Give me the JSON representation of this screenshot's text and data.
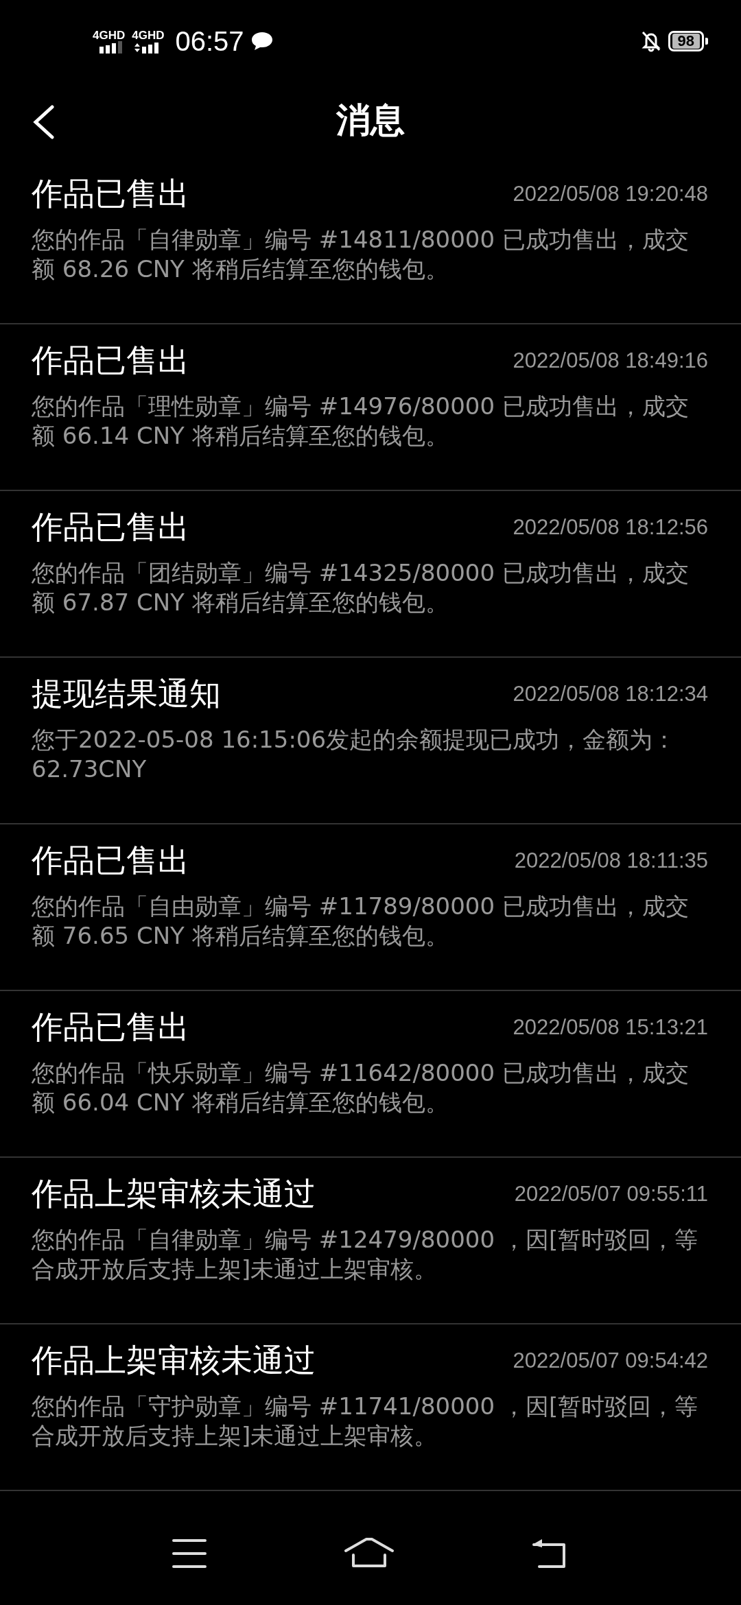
{
  "status_bar": {
    "network_1": "4GHD",
    "network_2": "4GHD",
    "time": "06:57",
    "battery": "98"
  },
  "header": {
    "title": "消息"
  },
  "messages": [
    {
      "title": "作品已售出",
      "time": "2022/05/08 19:20:48",
      "body": "您的作品「自律勋章」编号 #14811/80000 已成功售出，成交额 68.26 CNY 将稍后结算至您的钱包。"
    },
    {
      "title": "作品已售出",
      "time": "2022/05/08 18:49:16",
      "body": "您的作品「理性勋章」编号 #14976/80000 已成功售出，成交额 66.14 CNY 将稍后结算至您的钱包。"
    },
    {
      "title": "作品已售出",
      "time": "2022/05/08 18:12:56",
      "body": "您的作品「团结勋章」编号 #14325/80000 已成功售出，成交额 67.87 CNY 将稍后结算至您的钱包。"
    },
    {
      "title": "提现结果通知",
      "time": "2022/05/08 18:12:34",
      "body": "您于2022-05-08 16:15:06发起的余额提现已成功，金额为：62.73CNY"
    },
    {
      "title": "作品已售出",
      "time": "2022/05/08 18:11:35",
      "body": "您的作品「自由勋章」编号 #11789/80000 已成功售出，成交额 76.65 CNY 将稍后结算至您的钱包。"
    },
    {
      "title": "作品已售出",
      "time": "2022/05/08 15:13:21",
      "body": "您的作品「快乐勋章」编号 #11642/80000 已成功售出，成交额 66.04 CNY 将稍后结算至您的钱包。"
    },
    {
      "title": "作品上架审核未通过",
      "time": "2022/05/07 09:55:11",
      "body": "您的作品「自律勋章」编号 #12479/80000 ，因[暂时驳回，等合成开放后支持上架]未通过上架审核。"
    },
    {
      "title": "作品上架审核未通过",
      "time": "2022/05/07 09:54:42",
      "body": "您的作品「守护勋章」编号 #11741/80000 ，因[暂时驳回，等合成开放后支持上架]未通过上架审核。"
    }
  ]
}
